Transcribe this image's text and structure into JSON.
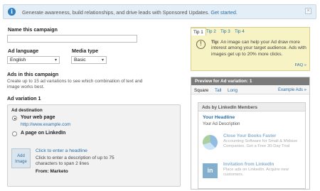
{
  "banner": {
    "text": "Generate awareness, build relationships, and drive leads with Sponsored Updates.",
    "link": "Get started.",
    "close": "×"
  },
  "form": {
    "campaign_name_label": "Name this campaign",
    "campaign_name_value": "",
    "ad_language_label": "Ad language",
    "ad_language_value": "English",
    "media_type_label": "Media type",
    "media_type_value": "Basic",
    "ads_section_title": "Ads in this campaign",
    "ads_section_desc": "Create up to 15 ad variations to see which combination of text and image works best.",
    "ad_variation_title": "Ad variation 1"
  },
  "destination": {
    "title": "Ad destination",
    "option1_label": "Your web page",
    "option1_url": "http://www.example.com",
    "option2_label": "A page on LinkedIn",
    "add_image": "Add Image",
    "headline_placeholder": "Click to enter a headline",
    "description_placeholder": "Click to enter a description of up to 75 characters to span 2 lines",
    "from": "From: Marketo"
  },
  "tips": {
    "tabs": [
      "Tip 1",
      "Tip 2",
      "Tip 3",
      "Tip 4"
    ],
    "prefix": "Tip",
    "text": ": An image can help your Ad draw more interest among your target audience. Ads with images get up to 20% more clicks.",
    "faq": "FAQ »"
  },
  "preview": {
    "header": "Preview for Ad variation: 1",
    "tabs": [
      "Square",
      "Tall",
      "Long"
    ],
    "example_ads": "Example Ads »",
    "panel_title": "Ads by LinkedIn Members",
    "headline": "Your Headline",
    "description": "Your Ad Description",
    "sponsored": [
      {
        "title": "Close Your Books Faster",
        "desc": "Accounting Software for Small & Midsize Companies. Get a Free 30-Day Trial"
      },
      {
        "title": "Invitation from LinkedIn",
        "desc": "Place ads on LinkedIn. Acquire new customers."
      }
    ]
  },
  "colors": {
    "accent": "#2b6fa5",
    "banner_bg": "#e3eef6",
    "tip_bg": "#f8f3c4",
    "preview_header": "#7a7a7a"
  }
}
